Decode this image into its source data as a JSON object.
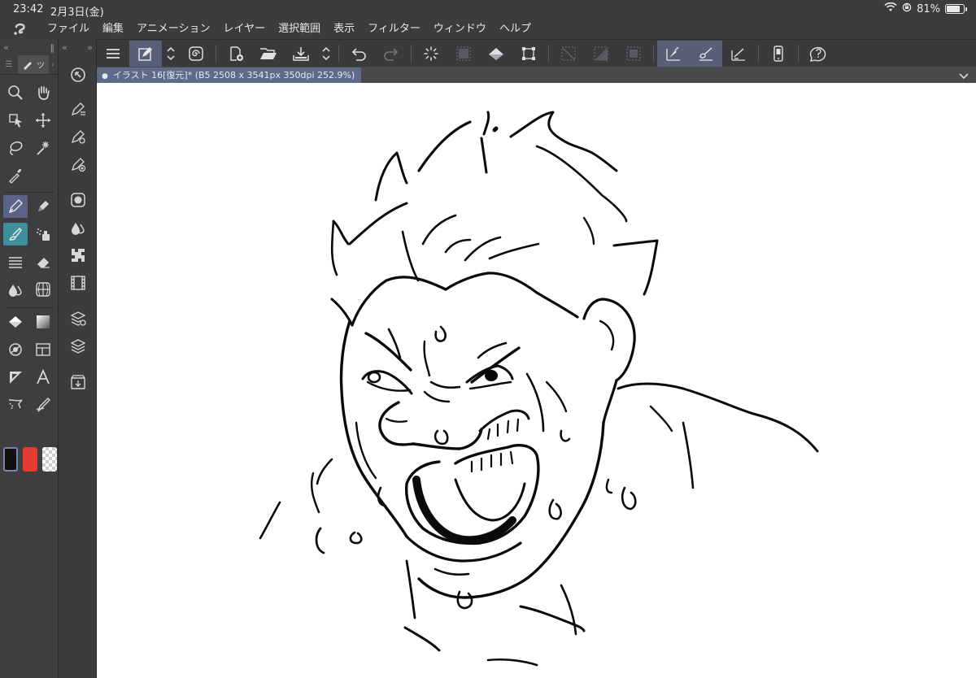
{
  "status": {
    "time": "23:42",
    "date": "2月3日(金)",
    "battery_text": "81%",
    "battery_level": 0.81,
    "icons": [
      "wifi-icon",
      "orientation-lock-icon",
      "battery-icon"
    ]
  },
  "menubar": {
    "logo_icon": "clip-studio-logo-icon",
    "items": [
      {
        "label": "ファイル"
      },
      {
        "label": "編集"
      },
      {
        "label": "アニメーション"
      },
      {
        "label": "レイヤー"
      },
      {
        "label": "選択範囲"
      },
      {
        "label": "表示"
      },
      {
        "label": "フィルター"
      },
      {
        "label": "ウィンドウ"
      },
      {
        "label": "ヘルプ"
      }
    ]
  },
  "toolbar": {
    "icons": [
      "menu-icon",
      "simple-mode-icon",
      "up-down-chevron-icon",
      "spiral-icon",
      "new-file-icon",
      "open-folder-icon",
      "save-icon",
      "up-down-chevron-icon",
      "undo-icon",
      "redo-icon",
      "loading-icon",
      "select-all-icon",
      "fill-icon",
      "transform-icon",
      "deselect-icon",
      "invert-selection-icon",
      "selection-border-icon",
      "pen-pressure-icon",
      "brush-pressure-icon",
      "ruler-icon",
      "smartphone-icon",
      "help-icon"
    ]
  },
  "document": {
    "tab_title": "イラスト 16[復元]* (B5 2508 x 3541px 350dpi 252.9%)"
  },
  "tools": {
    "panel_tab_label": "ツ",
    "icons": [
      "zoom-icon",
      "hand-icon",
      "object-select-icon",
      "move-icon",
      "lasso-icon",
      "magic-wand-icon",
      "eyedropper-icon",
      "pen-icon",
      "pencil-icon",
      "brush-icon",
      "airbrush-icon",
      "decoration-icon",
      "eraser-icon",
      "blend-icon",
      "figure-icon",
      "fill-icon",
      "gradient-icon",
      "shape-icon",
      "frame-icon",
      "ruler-icon",
      "text-icon",
      "balloon-icon",
      "correction-line-icon"
    ]
  },
  "colors": {
    "main": "#111111",
    "sub": "#e53a2e",
    "transparent_icon": "transparency-checker-icon"
  },
  "subtools": {
    "icons": [
      "navigator-icon",
      "sub-tool-pen-icon",
      "tool-property-icon",
      "brush-size-icon",
      "color-circle-icon",
      "color-slider-icon",
      "color-set-icon",
      "intermediate-color-icon",
      "layer-property-icon",
      "layer-icon",
      "material-icon"
    ]
  }
}
